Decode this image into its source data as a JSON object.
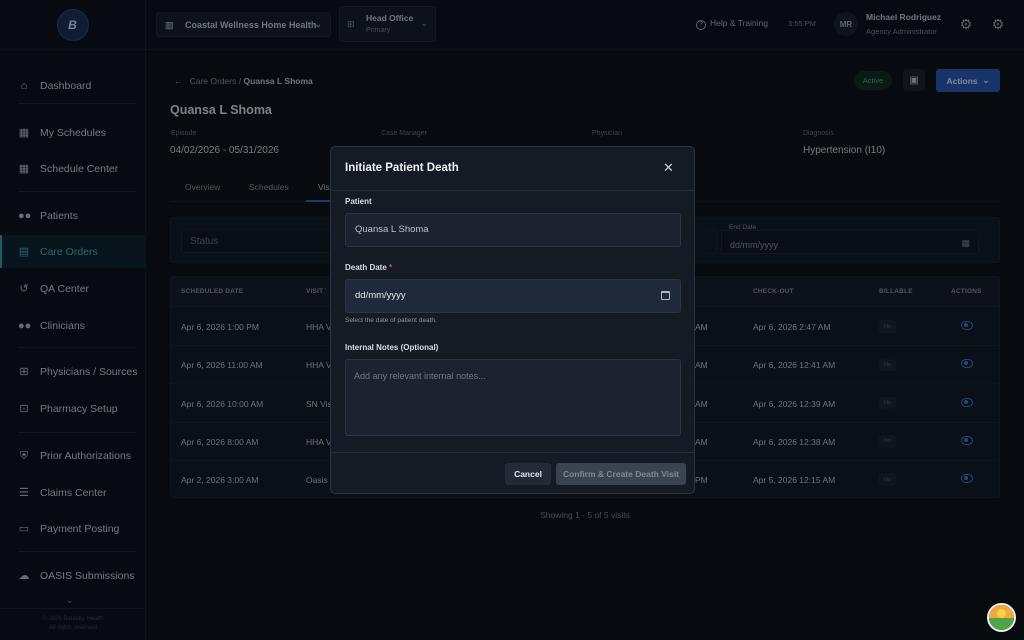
{
  "sidebar": {
    "logo_text": "B",
    "items": [
      {
        "label": "Dashboard",
        "icon": "home-icon"
      },
      {
        "label": "My Schedules",
        "icon": "calendar-icon"
      },
      {
        "label": "Schedule Center",
        "icon": "calendar-icon"
      },
      {
        "label": "Patients",
        "icon": "users-icon"
      },
      {
        "label": "Care Orders",
        "icon": "clipboard-icon"
      },
      {
        "label": "QA Center",
        "icon": "history-icon"
      },
      {
        "label": "Clinicians",
        "icon": "users-icon"
      },
      {
        "label": "Physicians / Sources",
        "icon": "plus-square-icon"
      },
      {
        "label": "Pharmacy Setup",
        "icon": "pharmacy-icon"
      },
      {
        "label": "Prior Authorizations",
        "icon": "shield-check-icon"
      },
      {
        "label": "Claims Center",
        "icon": "list-icon"
      },
      {
        "label": "Payment Posting",
        "icon": "credit-card-icon"
      },
      {
        "label": "OASIS Submissions",
        "icon": "cloud-upload-icon"
      }
    ],
    "active_item": "Care Orders",
    "footer_line1": "© 2026 Betasky Health",
    "footer_line2": "All rights reserved"
  },
  "topbar": {
    "agency": "Coastal Wellness Home Health",
    "office_name": "Head Office",
    "office_sub": "Primary",
    "help_label": "Help & Training",
    "time": "3:55 PM",
    "avatar_initials": "MR",
    "user_name": "Michael Rodriguez",
    "user_role": "Agency Administrator"
  },
  "page": {
    "breadcrumb_parent": "Care Orders",
    "breadcrumb_sep": "/",
    "breadcrumb_current": "Quansa L Shoma",
    "title": "Quansa L Shoma",
    "status_badge": "Active",
    "actions_label": "Actions",
    "info": [
      {
        "label": "Episode",
        "value": "04/02/2026 - 05/31/2026"
      },
      {
        "label": "Case Manager",
        "value": ""
      },
      {
        "label": "Physician",
        "value": ""
      },
      {
        "label": "Diagnosis",
        "value": "Hypertension (I10)"
      }
    ],
    "tabs": [
      "Overview",
      "Schedules",
      "Visits"
    ],
    "active_tab": "Visits",
    "filters": {
      "status_placeholder": "Status",
      "end_date_label": "End Date",
      "end_date_placeholder": "dd/mm/yyyy"
    },
    "table": {
      "columns": [
        "SCHEDULED DATE",
        "VISIT TYPE",
        "CHECK-OUT",
        "BILLABLE",
        "ACTIONS"
      ],
      "rows": [
        {
          "scheduled": "Apr 6, 2026 1:00 PM",
          "visit": "HHA Visit",
          "checkin_suffix": "AM",
          "checkout": "Apr 6, 2026 2:47 AM",
          "billable": "No"
        },
        {
          "scheduled": "Apr 6, 2026 11:00 AM",
          "visit": "HHA Visit",
          "checkin_suffix": "AM",
          "checkout": "Apr 6, 2026 12:41 AM",
          "billable": "No"
        },
        {
          "scheduled": "Apr 6, 2026 10:00 AM",
          "visit": "SN Visit",
          "checkin_suffix": "AM",
          "checkout": "Apr 6, 2026 12:39 AM",
          "billable": "No"
        },
        {
          "scheduled": "Apr 6, 2026 8:00 AM",
          "visit": "HHA Visit",
          "checkin_suffix": "AM",
          "checkout": "Apr 6, 2026 12:38 AM",
          "billable": "No"
        },
        {
          "scheduled": "Apr 2, 2026 3:00 AM",
          "visit": "Oasis",
          "checkin_suffix": "PM",
          "checkout": "Apr 5, 2026 12:15 AM",
          "billable": "No"
        }
      ]
    },
    "showing": "Showing 1 - 5 of 5 visits"
  },
  "modal": {
    "title": "Initiate Patient Death",
    "patient_label": "Patient",
    "patient_value": "Quansa L Shoma",
    "death_date_label": "Death Date",
    "required_mark": "*",
    "death_date_placeholder": "dd/mm/yyyy",
    "death_date_help": "Select the date of patient death.",
    "notes_label": "Internal Notes (Optional)",
    "notes_placeholder": "Add any relevant internal notes...",
    "cancel_label": "Cancel",
    "confirm_label": "Confirm & Create Death Visit"
  },
  "colors": {
    "accent_active": "#2aa3b5",
    "primary_button": "#2d5ab8",
    "status_active": "#4db873",
    "required": "#e04b4b"
  }
}
